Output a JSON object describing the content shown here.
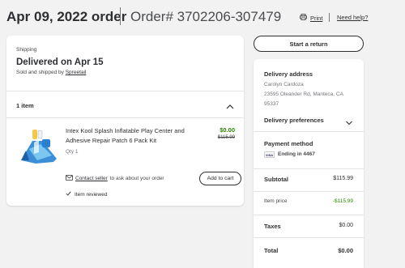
{
  "header": {
    "order_date": "Apr 09, 2022 order",
    "order_number": "Order# 3702206-307479",
    "print_label": "Print",
    "help_label": "Need help?"
  },
  "shipment": {
    "section_label": "Shipping",
    "status": "Delivered on Apr 15",
    "sold_prefix": "Sold and shipped by",
    "seller": "Spreetail",
    "items_count": "1 item"
  },
  "item": {
    "name": "Intex Kool Splash Inflatable Play Center and Adhesive Repair Patch 6 Pack Kit",
    "price": "$0.00",
    "original_price": "$115.99",
    "qty": "Qty 1",
    "contact_link": "Contact seller",
    "contact_suffix": "to ask about your order",
    "add_to_cart": "Add to cart",
    "reviewed": "Item reviewed"
  },
  "actions": {
    "start_return": "Start a return"
  },
  "summary": {
    "delivery_address_title": "Delivery address",
    "address_name": "Carolyn Cardoza",
    "address_line": "23595 Oleander Rd, Manteca, CA 95337",
    "delivery_preferences": "Delivery preferences",
    "payment_method_title": "Payment method",
    "card_brand": "VISA",
    "card_ending": "Ending in 4467",
    "subtotal_label": "Subtotal",
    "subtotal_value": "$115.99",
    "item_price_label": "Item price",
    "item_price_value": "-$115.99",
    "taxes_label": "Taxes",
    "taxes_value": "$0.00",
    "total_label": "Total",
    "total_value": "$0.00"
  },
  "colors": {
    "accent_green": "#2a8703",
    "text_primary": "#2e2f32",
    "page_bg": "#f2f2f2"
  }
}
